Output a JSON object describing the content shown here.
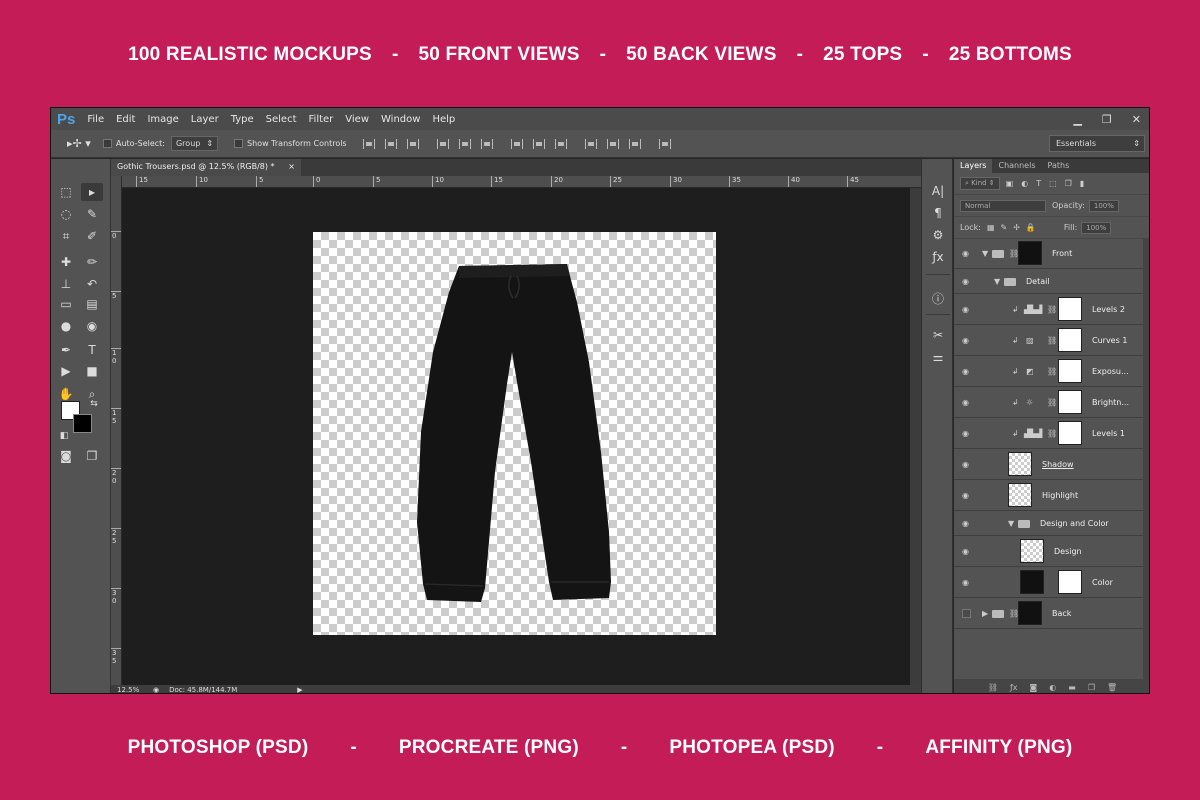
{
  "top_banner": [
    "100 REALISTIC MOCKUPS",
    "50 FRONT VIEWS",
    "50 BACK VIEWS",
    "25 TOPS",
    "25 BOTTOMS"
  ],
  "bottom_banner": [
    "PHOTOSHOP (PSD)",
    "PROCREATE (PNG)",
    "PHOTOPEA (PSD)",
    "AFFINITY (PNG)"
  ],
  "separator": "-",
  "app": {
    "logo": "Ps",
    "menu": [
      "File",
      "Edit",
      "Image",
      "Layer",
      "Type",
      "Select",
      "Filter",
      "View",
      "Window",
      "Help"
    ],
    "window_controls": [
      "▁",
      "❐",
      "✕"
    ]
  },
  "options": {
    "auto_select": "Auto-Select:",
    "group": "Group",
    "show_transform": "Show Transform Controls",
    "workspace": "Essentials"
  },
  "document": {
    "tab_title": "Gothic Trousers.psd @ 12.5% (RGB/8) *",
    "close": "×",
    "ruler_h": [
      "15",
      "10",
      "5",
      "0",
      "5",
      "10",
      "15",
      "20",
      "25",
      "30",
      "35",
      "40",
      "45"
    ],
    "ruler_v": [
      "0",
      "5",
      "1 0",
      "1 5",
      "2 0",
      "2 5",
      "3 0",
      "3 5"
    ]
  },
  "status": {
    "zoom": "12.5%",
    "doc_info": "Doc: 45.8M/144.7M"
  },
  "panel": {
    "tabs": [
      "Layers",
      "Channels",
      "Paths"
    ],
    "kind": "Kind",
    "blend": "Normal",
    "opacity_label": "Opacity:",
    "opacity_value": "100%",
    "lock_label": "Lock:",
    "fill_label": "Fill:",
    "fill_value": "100%",
    "layers": [
      {
        "name": "Front"
      },
      {
        "name": "Detail"
      },
      {
        "name": "Levels 2"
      },
      {
        "name": "Curves 1"
      },
      {
        "name": "Exposu..."
      },
      {
        "name": "Brightn..."
      },
      {
        "name": "Levels 1"
      },
      {
        "name": "Shadow"
      },
      {
        "name": "Highlight"
      },
      {
        "name": "Design and Color"
      },
      {
        "name": "Design"
      },
      {
        "name": "Color"
      },
      {
        "name": "Back"
      }
    ]
  },
  "colors": {
    "background": "#c41c56",
    "garment": "#141414",
    "ps_blue": "#4fa3e8"
  }
}
